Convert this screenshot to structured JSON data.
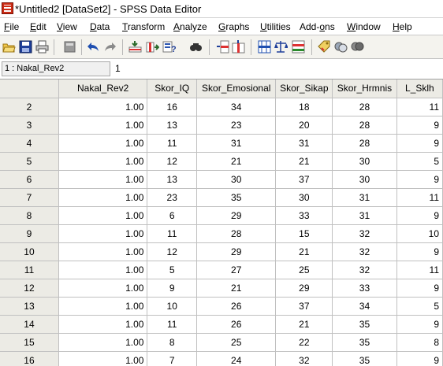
{
  "window": {
    "title": "*Untitled2 [DataSet2] - SPSS Data Editor"
  },
  "menu": [
    {
      "key": "file",
      "pre": "",
      "ul": "F",
      "post": "ile"
    },
    {
      "key": "edit",
      "pre": "",
      "ul": "E",
      "post": "dit"
    },
    {
      "key": "view",
      "pre": "",
      "ul": "V",
      "post": "iew"
    },
    {
      "key": "data",
      "pre": "",
      "ul": "D",
      "post": "ata"
    },
    {
      "key": "transform",
      "pre": "",
      "ul": "T",
      "post": "ransform"
    },
    {
      "key": "analyze",
      "pre": "",
      "ul": "A",
      "post": "nalyze"
    },
    {
      "key": "graphs",
      "pre": "",
      "ul": "G",
      "post": "raphs"
    },
    {
      "key": "utilities",
      "pre": "",
      "ul": "U",
      "post": "tilities"
    },
    {
      "key": "addons",
      "pre": "Add-",
      "ul": "o",
      "post": "ns"
    },
    {
      "key": "window",
      "pre": "",
      "ul": "W",
      "post": "indow"
    },
    {
      "key": "help",
      "pre": "",
      "ul": "H",
      "post": "elp"
    }
  ],
  "toolbar": {
    "icons": [
      "open-icon",
      "save-icon",
      "print-icon",
      "dialog-recall-icon",
      "undo-icon",
      "redo-icon",
      "goto-case-icon",
      "goto-variable-icon",
      "variables-icon",
      "find-icon",
      "insert-cases-icon",
      "insert-variable-icon",
      "split-file-icon",
      "weight-cases-icon",
      "select-cases-icon",
      "value-labels-icon",
      "use-sets-icon",
      "show-all-icon"
    ]
  },
  "cell_editor": {
    "reference": "1 : Nakal_Rev2",
    "value": "1"
  },
  "grid": {
    "columns": [
      "Nakal_Rev2",
      "Skor_IQ",
      "Skor_Emosional",
      "Skor_Sikap",
      "Skor_Hrmnis",
      "L_Sklh"
    ],
    "rows": [
      {
        "n": "2",
        "cells": [
          "1.00",
          "16",
          "34",
          "18",
          "28",
          "11"
        ]
      },
      {
        "n": "3",
        "cells": [
          "1.00",
          "13",
          "23",
          "20",
          "28",
          "9"
        ]
      },
      {
        "n": "4",
        "cells": [
          "1.00",
          "11",
          "31",
          "31",
          "28",
          "9"
        ]
      },
      {
        "n": "5",
        "cells": [
          "1.00",
          "12",
          "21",
          "21",
          "30",
          "5"
        ]
      },
      {
        "n": "6",
        "cells": [
          "1.00",
          "13",
          "30",
          "37",
          "30",
          "9"
        ]
      },
      {
        "n": "7",
        "cells": [
          "1.00",
          "23",
          "35",
          "30",
          "31",
          "11"
        ]
      },
      {
        "n": "8",
        "cells": [
          "1.00",
          "6",
          "29",
          "33",
          "31",
          "9"
        ]
      },
      {
        "n": "9",
        "cells": [
          "1.00",
          "11",
          "28",
          "15",
          "32",
          "10"
        ]
      },
      {
        "n": "10",
        "cells": [
          "1.00",
          "12",
          "29",
          "21",
          "32",
          "9"
        ]
      },
      {
        "n": "11",
        "cells": [
          "1.00",
          "5",
          "27",
          "25",
          "32",
          "11"
        ]
      },
      {
        "n": "12",
        "cells": [
          "1.00",
          "9",
          "21",
          "29",
          "33",
          "9"
        ]
      },
      {
        "n": "13",
        "cells": [
          "1.00",
          "10",
          "26",
          "37",
          "34",
          "5"
        ]
      },
      {
        "n": "14",
        "cells": [
          "1.00",
          "11",
          "26",
          "21",
          "35",
          "9"
        ]
      },
      {
        "n": "15",
        "cells": [
          "1.00",
          "8",
          "25",
          "22",
          "35",
          "8"
        ]
      },
      {
        "n": "16",
        "cells": [
          "1.00",
          "7",
          "24",
          "32",
          "35",
          "9"
        ]
      }
    ]
  }
}
